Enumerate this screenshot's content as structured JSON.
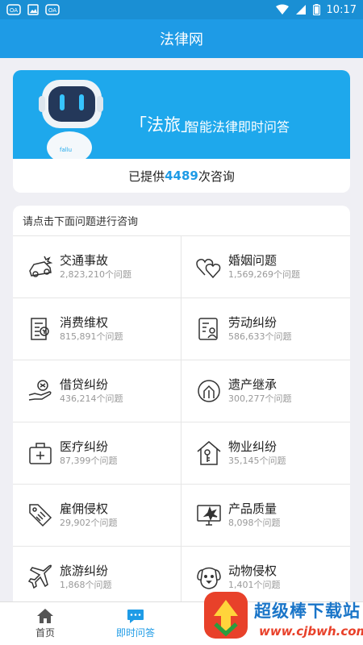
{
  "status_bar": {
    "time": "10:17",
    "icons_left": [
      "cast-icon",
      "image-icon",
      "cast-icon"
    ],
    "icons_right": [
      "wifi-icon",
      "signal-icon",
      "battery-icon"
    ]
  },
  "app_bar": {
    "title": "法律网"
  },
  "banner": {
    "brand": "「法旅」",
    "subtitle": "智能法律即时问答",
    "stats_prefix": "已提供",
    "stats_count": "4489",
    "stats_suffix": "次咨询"
  },
  "consult": {
    "heading": "请点击下面问题进行咨询",
    "categories": [
      {
        "title": "交通事故",
        "count": "2,823,210个问题",
        "icon": "car-crash-icon"
      },
      {
        "title": "婚姻问题",
        "count": "1,569,269个问题",
        "icon": "hearts-icon"
      },
      {
        "title": "消费维权",
        "count": "815,891个问题",
        "icon": "receipt-icon"
      },
      {
        "title": "劳动纠纷",
        "count": "586,633个问题",
        "icon": "worker-card-icon"
      },
      {
        "title": "借贷纠纷",
        "count": "436,214个问题",
        "icon": "hand-coin-icon"
      },
      {
        "title": "遗产继承",
        "count": "300,277个问题",
        "icon": "inheritance-icon"
      },
      {
        "title": "医疗纠纷",
        "count": "87,399个问题",
        "icon": "medical-kit-icon"
      },
      {
        "title": "物业纠纷",
        "count": "35,145个问题",
        "icon": "house-key-icon"
      },
      {
        "title": "雇佣侵权",
        "count": "29,902个问题",
        "icon": "tag-icon"
      },
      {
        "title": "产品质量",
        "count": "8,098个问题",
        "icon": "broken-monitor-icon"
      },
      {
        "title": "旅游纠纷",
        "count": "1,868个问题",
        "icon": "airplane-icon"
      },
      {
        "title": "动物侵权",
        "count": "1,401个问题",
        "icon": "dog-icon"
      }
    ]
  },
  "tabs": [
    {
      "label": "首页",
      "icon": "home-icon",
      "active": false
    },
    {
      "label": "即时问答",
      "icon": "chat-icon",
      "active": true
    }
  ],
  "watermark": {
    "title": "超级棒下载站",
    "url": "www.cjbwh.com"
  },
  "colors": {
    "primary": "#1e9be6",
    "banner": "#1ea8ec"
  }
}
